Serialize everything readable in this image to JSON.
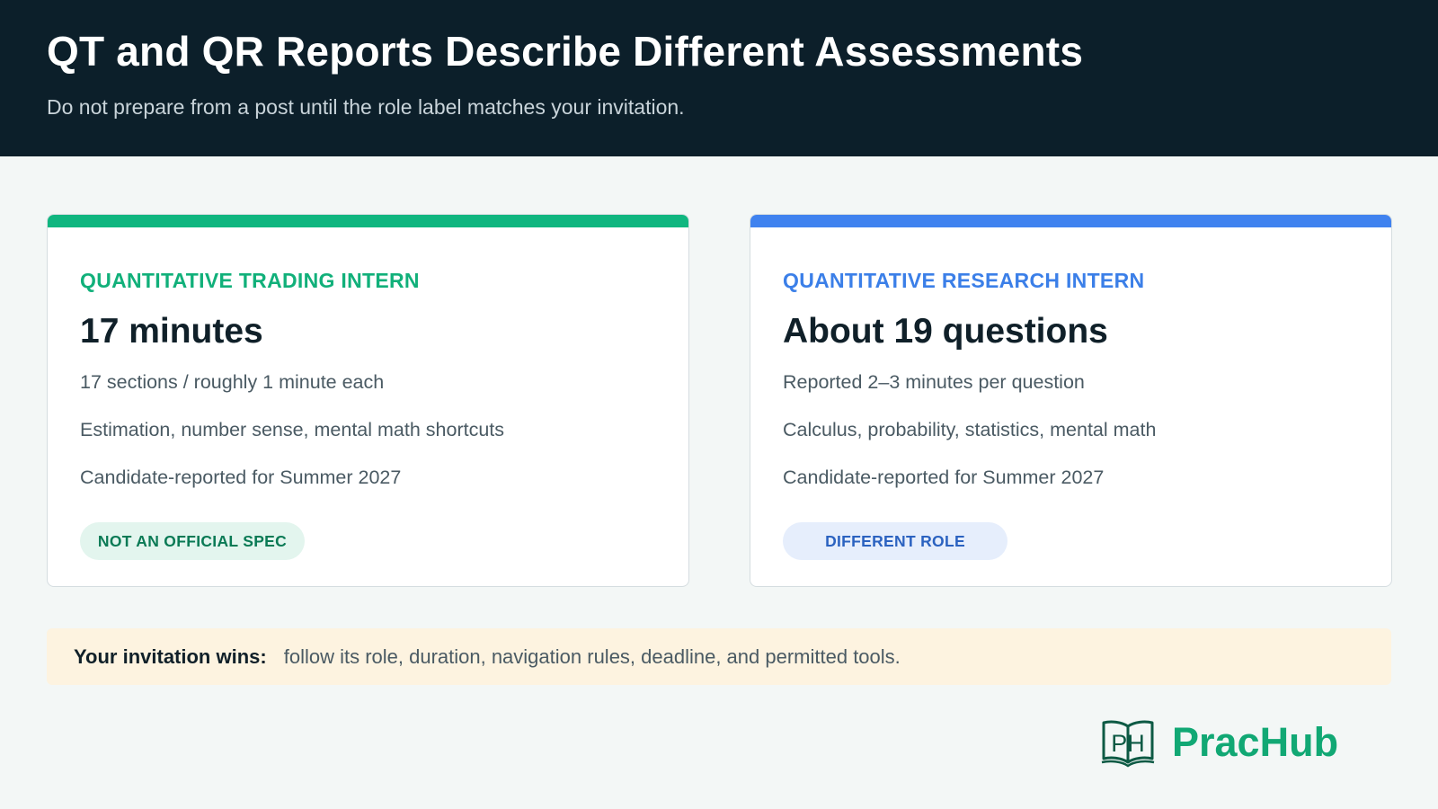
{
  "header": {
    "title": "QT and QR Reports Describe Different Assessments",
    "subtitle": "Do not prepare from a post until the role label matches your invitation."
  },
  "cards": [
    {
      "role": "QUANTITATIVE TRADING INTERN",
      "headline": "17 minutes",
      "lines": [
        "17 sections / roughly 1 minute each",
        "Estimation, number sense, mental math shortcuts",
        "Candidate-reported for Summer 2027"
      ],
      "tag": "NOT AN OFFICIAL SPEC",
      "accent": "#0fb67f"
    },
    {
      "role": "QUANTITATIVE RESEARCH INTERN",
      "headline": "About 19 questions",
      "lines": [
        "Reported 2–3 minutes per question",
        "Calculus, probability, statistics, mental math",
        "Candidate-reported for Summer 2027"
      ],
      "tag": "DIFFERENT ROLE",
      "accent": "#3f82ef"
    }
  ],
  "note": {
    "strong": "Your invitation wins:",
    "text": "follow its role, duration, navigation rules, deadline, and permitted tools."
  },
  "brand": {
    "logo_text": "PH",
    "name": "PracHub",
    "icon": "open-book-icon",
    "color": "#11a874"
  }
}
